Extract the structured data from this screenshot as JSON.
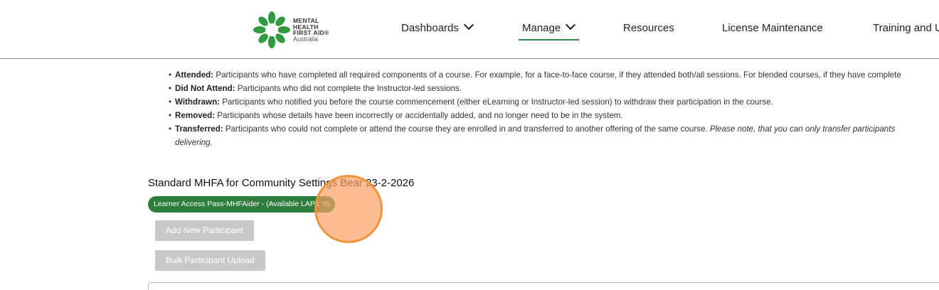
{
  "logo": {
    "line1": "MENTAL",
    "line2": "HEALTH",
    "line3": "FIRST AID®",
    "line4": "Australia"
  },
  "nav": {
    "dashboards": "Dashboards",
    "manage": "Manage",
    "resources": "Resources",
    "license": "License Maintenance",
    "training": "Training and U"
  },
  "statuses": [
    {
      "term": "Attended:",
      "text": " Participants who have completed all required components of a course. For example, for a face-to-face course, if they attended both/all sessions. For blended courses, if they have complete"
    },
    {
      "term": "Did Not Attend:",
      "text": " Participants who did not complete the Instructor-led sessions."
    },
    {
      "term": "Withdrawn:",
      "text": " Participants who notified you before the course commencement (either eLearning or Instructor-led session) to withdraw their participation in the course."
    },
    {
      "term": "Removed:",
      "text": " Participants whose details have been incorrectly or accidentally added, and no longer need to be in the system."
    },
    {
      "term": "Transferred:",
      "text": " Participants who could not complete or attend the course they are enrolled in and transferred to another offering of the same course. ",
      "note": "Please note, that you can only transfer participants",
      "note2": "delivering."
    }
  ],
  "course": {
    "title": "Standard MHFA for Community Settings Bear 23-2-2026",
    "badge": "Learner Access Pass-MHFAider - (Available LAPs: 0)",
    "add_button": "Add New Participant",
    "bulk_button": "Bulk Participant Upload"
  },
  "colors": {
    "brand_green": "#2d7d3c",
    "disabled_button": "#c8c8c8",
    "highlight": "#f0923a"
  }
}
